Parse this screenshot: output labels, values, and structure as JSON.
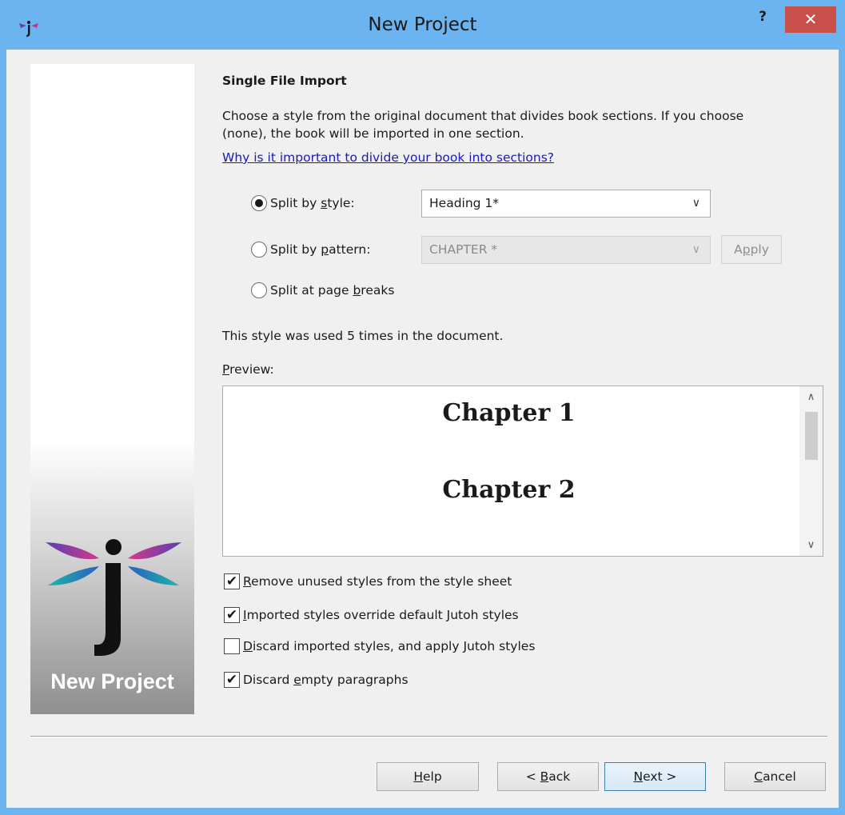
{
  "window": {
    "title": "New Project",
    "help_label": "?",
    "close_label": "✕"
  },
  "side_panel": {
    "caption": "New Project",
    "colors": {
      "gradient_top": "#ffffff",
      "gradient_bottom": "#8f8f8f"
    }
  },
  "content": {
    "heading": "Single File Import",
    "description": "Choose a style from the original document that divides book sections. If you choose (none), the book will be imported in one section.",
    "link": "Why is it important to divide your book into sections?"
  },
  "split_options": {
    "by_style": {
      "pre": "Split by ",
      "key": "s",
      "post": "tyle:",
      "selected": true,
      "value": "Heading 1*"
    },
    "by_pattern": {
      "pre": "Split by ",
      "key": "p",
      "post": "attern:",
      "selected": false,
      "value": "CHAPTER *",
      "apply_pre": "A",
      "apply_key": "p",
      "apply_post": "ply"
    },
    "page_breaks": {
      "pre": "Split at page ",
      "key": "b",
      "post": "reaks",
      "selected": false
    }
  },
  "usage_text": "This style was used 5 times in the document.",
  "preview": {
    "label_key": "P",
    "label_rest": "review:",
    "lines": [
      "Chapter 1",
      "Chapter 2"
    ]
  },
  "checkboxes": [
    {
      "key": "R",
      "rest": "emove unused styles from the style sheet",
      "checked": true
    },
    {
      "key": "I",
      "rest": "mported styles override default Jutoh styles",
      "checked": true
    },
    {
      "key": "D",
      "rest": "iscard imported styles, and apply Jutoh styles",
      "checked": false
    },
    {
      "pre": "Discard ",
      "key": "e",
      "rest": "mpty paragraphs",
      "checked": true
    }
  ],
  "buttons": {
    "help": {
      "key": "H",
      "rest": "elp"
    },
    "back": {
      "pre": "< ",
      "key": "B",
      "rest": "ack"
    },
    "next": {
      "key": "N",
      "rest": "ext >"
    },
    "cancel": {
      "key": "C",
      "rest": "ancel"
    }
  },
  "colors": {
    "titlebar": "#6cb4ef",
    "close_button": "#c9504a",
    "link": "#1a1ab8",
    "default_button_border": "#3c7fb1"
  }
}
